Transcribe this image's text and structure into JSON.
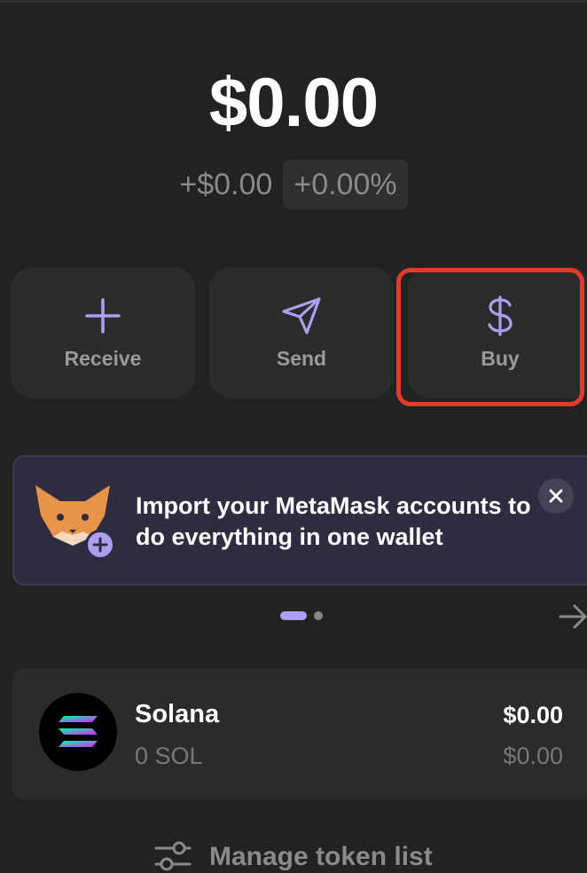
{
  "balance": {
    "total": "$0.00",
    "change_abs": "+$0.00",
    "change_pct": "+0.00%"
  },
  "actions": {
    "receive": "Receive",
    "send": "Send",
    "buy": "Buy"
  },
  "banner": {
    "text": "Import your MetaMask accounts to do everything in one wallet",
    "close_label": "✕"
  },
  "carousel": {
    "next": "→"
  },
  "tokens": [
    {
      "name": "Solana",
      "amount": "0 SOL",
      "value": "$0.00",
      "value_secondary": "$0.00"
    }
  ],
  "footer": {
    "manage_label": "Manage token list"
  },
  "colors": {
    "accent": "#ab9ff2",
    "highlight": "#e23a2b",
    "background": "#222222"
  }
}
